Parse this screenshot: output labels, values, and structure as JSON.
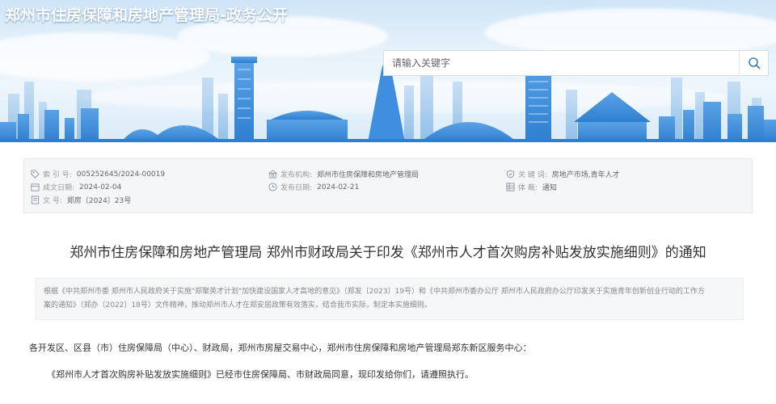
{
  "header": {
    "site_title": "郑州市住房保障和房地产管理局-政务公开",
    "search_placeholder": "请输入关键字"
  },
  "meta": {
    "index_no": {
      "label": "索 引 号:",
      "value": "005252645/2024-00019"
    },
    "publisher": {
      "label": "发布机构:",
      "value": "郑州市住房保障和房地产管理局"
    },
    "keywords": {
      "label": "关 键 词:",
      "value": "房地产市场,青年人才"
    },
    "created": {
      "label": "成文日期:",
      "value": "2024-02-04"
    },
    "published": {
      "label": "发布日期:",
      "value": "2024-02-21"
    },
    "category": {
      "label": "体     裁:",
      "value": "通知"
    },
    "doc_no": {
      "label": "文     号:",
      "value": "郑房〔2024〕23号"
    }
  },
  "doc": {
    "title": "郑州市住房保障和房地产管理局 郑州市财政局关于印发《郑州市人才首次购房补贴发放实施细则》的通知",
    "summary_line1": "根据《中共郑州市委 郑州市人民政府关于实施\"郑聚英才计划\"加快建设国家人才高地的意见》（郑发〔2023〕19号）和《中共郑州市委办公厅 郑州市人民政府办公厅印发关于实施青年创新创业行动的工作方",
    "summary_line2": "案的通知》（郑办〔2022〕18号）文件精神，推动郑州市人才在郑安居政策有效落实，结合我市实际，制定本实施细则。",
    "recipients": "各开发区、区县（市）住房保障局（中心）、财政局，郑州市房屋交易中心，郑州市住房保障和房地产管理局郑东新区服务中心：",
    "paragraph1": "《郑州市人才首次购房补贴发放实施细则》已经市住房保障局、市财政局同意，现印发给你们，请遵照执行。"
  },
  "icons": {
    "search": "search-icon",
    "tag": "tag-icon",
    "building": "building-icon",
    "shield": "shield-icon",
    "calendar": "calendar-icon",
    "clock": "clock-icon",
    "grid": "grid-icon",
    "doc": "document-icon"
  },
  "colors": {
    "banner_top": "#cfe5f7",
    "skyline_blue": "#3b8ad9",
    "meta_bg": "#f5f6f8",
    "search_icon": "#3a7fc4"
  }
}
